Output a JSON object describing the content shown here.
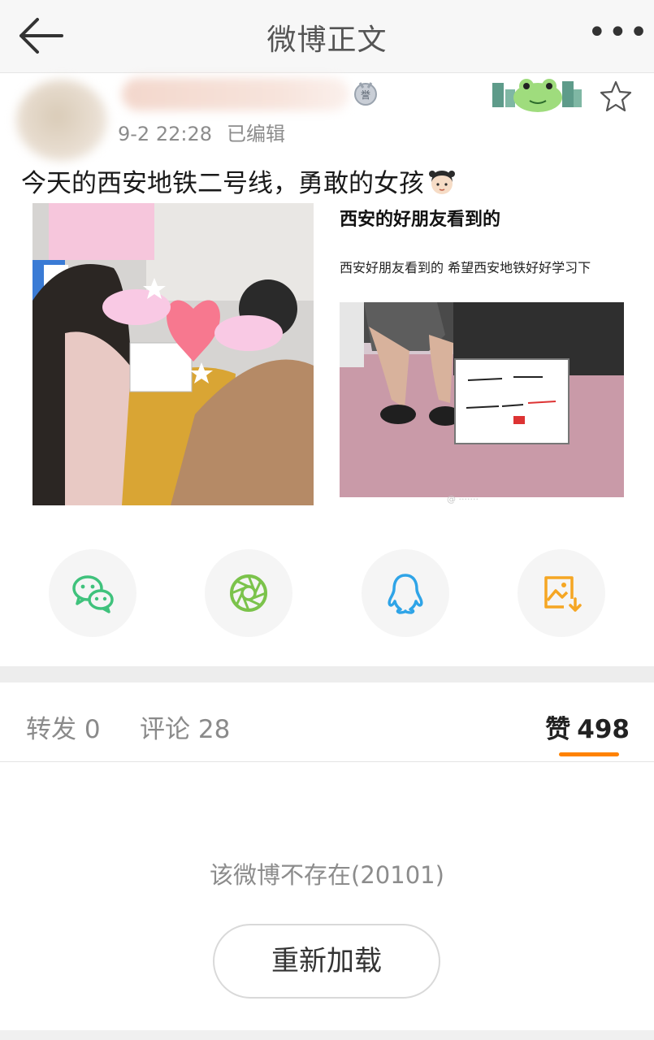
{
  "topbar": {
    "title": "微博正文",
    "more_label": "•••",
    "icons": {
      "back": "arrow-left-icon",
      "more": "more-dots-icon"
    }
  },
  "post": {
    "time": "9-2 22:28",
    "edited_label": "已编辑",
    "text": "今天的西安地铁二号线，勇敢的女孩",
    "icons": {
      "medal": "medal-badge-icon",
      "favorite": "star-outline-icon",
      "emoji": "girl-emoji-icon"
    }
  },
  "images": {
    "right_title": "西安的好朋友看到的",
    "right_caption": "西安好朋友看到的 希望西安地铁好好学习下"
  },
  "share": {
    "items": [
      {
        "name": "wechat",
        "icon": "wechat-icon",
        "color": "#3fc27c"
      },
      {
        "name": "moments",
        "icon": "wechat-moments-icon",
        "color": "#7bc34b"
      },
      {
        "name": "qq",
        "icon": "qq-icon",
        "color": "#2fa4e7"
      },
      {
        "name": "save-image",
        "icon": "save-image-icon",
        "color": "#f5a623"
      }
    ]
  },
  "tabs": {
    "repost": "转发 0",
    "comments": "评论 28",
    "likes_label": "赞",
    "likes_count": "498",
    "active_color": "#ff8200"
  },
  "comments_area": {
    "error": "该微博不存在(20101)",
    "reload": "重新加载"
  }
}
